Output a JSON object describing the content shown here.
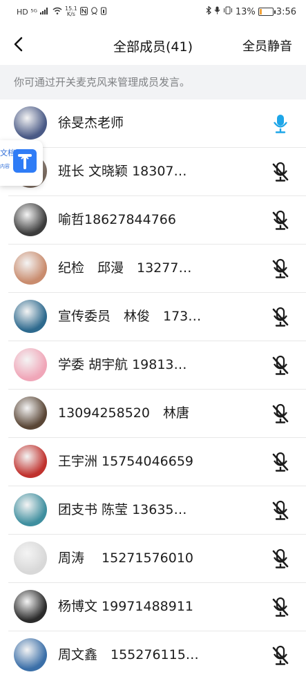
{
  "status_bar": {
    "left_indicators": "HD ⁵ᴳ",
    "net_speed": "15.1",
    "net_unit": "K/s",
    "battery": "13%",
    "time": "3:56",
    "battery_color": "#f2a33a"
  },
  "header": {
    "title": "全部成员(41)",
    "mute_all_label": "全员静音"
  },
  "hint": "你可通过开关麦克风来管理成员发言。",
  "floating_widget": {
    "label_top": "文档",
    "label_bottom": "内容"
  },
  "members": [
    {
      "name": "徐旻杰老师",
      "mic": "on",
      "avatar_color": "#4a5a86"
    },
    {
      "name": "班长 文晓颖 18307…",
      "mic": "off",
      "avatar_color": "#7a6b60"
    },
    {
      "name": "喻哲18627844766",
      "mic": "off",
      "avatar_color": "#3c3c3c"
    },
    {
      "name": "纪检　邱漫　13277…",
      "mic": "off",
      "avatar_color": "#c98c6e"
    },
    {
      "name": "宣传委员　林俊　173…",
      "mic": "off",
      "avatar_color": "#2e6a8e"
    },
    {
      "name": "学委 胡宇航 19813…",
      "mic": "off",
      "avatar_color": "#f0a6b8"
    },
    {
      "name": "13094258520　林唐",
      "mic": "off",
      "avatar_color": "#5a4636"
    },
    {
      "name": "王宇洲 15754046659",
      "mic": "off",
      "avatar_color": "#c0322e"
    },
    {
      "name": "团支书 陈莹 13635…",
      "mic": "off",
      "avatar_color": "#3f8f9f"
    },
    {
      "name": "周涛　 15271576010",
      "mic": "off",
      "avatar_color": "#d8d8d8"
    },
    {
      "name": "杨博文 19971488911",
      "mic": "off",
      "avatar_color": "#2b2b2b"
    },
    {
      "name": "周文鑫　155276115…",
      "mic": "off",
      "avatar_color": "#3b6fa8"
    }
  ],
  "colors": {
    "mic_on": "#1ea6e8",
    "mic_off": "#1c1c1c",
    "hint_bg": "#f2f3f5"
  },
  "icons": {
    "back": "chevron-left-icon",
    "mic_on": "microphone-icon",
    "mic_off": "microphone-muted-icon"
  }
}
